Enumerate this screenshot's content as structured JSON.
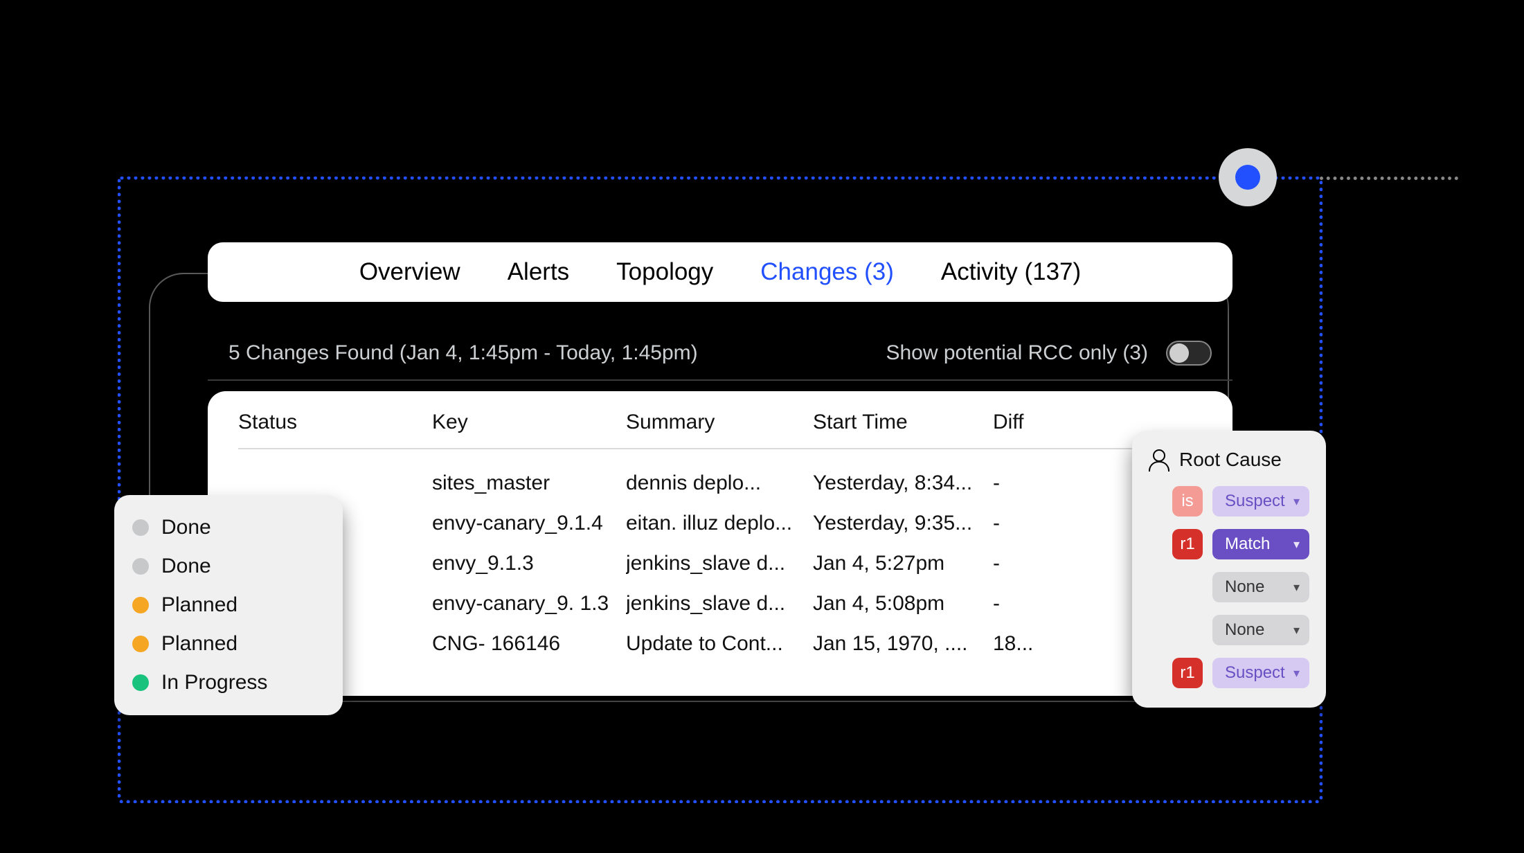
{
  "tabs": {
    "overview": "Overview",
    "alerts": "Alerts",
    "topology": "Topology",
    "changes": "Changes (3)",
    "activity": "Activity (137)"
  },
  "subheader": {
    "found": "5 Changes Found (Jan 4, 1:45pm - Today, 1:45pm)",
    "rcc_label": "Show potential RCC only (3)"
  },
  "table": {
    "headers": {
      "status": "Status",
      "key": "Key",
      "summary": "Summary",
      "start": "Start Time",
      "diff": "Diff"
    },
    "rows": [
      {
        "key": "sites_master",
        "summary": "dennis deplo...",
        "start": "Yesterday, 8:34...",
        "diff": "-"
      },
      {
        "key": "envy-canary_9.1.4",
        "summary": "eitan. illuz deplo...",
        "start": "Yesterday, 9:35...",
        "diff": "-"
      },
      {
        "key": "envy_9.1.3",
        "summary": "jenkins_slave d...",
        "start": "Jan 4, 5:27pm",
        "diff": "-"
      },
      {
        "key": "envy-canary_9. 1.3",
        "summary": "jenkins_slave d...",
        "start": "Jan 4, 5:08pm",
        "diff": "-"
      },
      {
        "key": "CNG- 166146",
        "summary": "Update to Cont...",
        "start": "Jan 15, 1970, ....",
        "diff": "18..."
      }
    ]
  },
  "status_card": {
    "items": [
      {
        "label": "Done",
        "color": "grey"
      },
      {
        "label": "Done",
        "color": "grey"
      },
      {
        "label": "Planned",
        "color": "orange"
      },
      {
        "label": "Planned",
        "color": "orange"
      },
      {
        "label": " In Progress",
        "color": "green"
      }
    ]
  },
  "root_cause": {
    "title": "Root Cause",
    "rows": [
      {
        "badge": "is",
        "badge_style": "pink",
        "pill": "Suspect",
        "pill_style": "lav"
      },
      {
        "badge": "r1",
        "badge_style": "red",
        "pill": "Match",
        "pill_style": "purple"
      },
      {
        "badge": "",
        "badge_style": "",
        "pill": "None",
        "pill_style": "grey"
      },
      {
        "badge": "",
        "badge_style": "",
        "pill": "None",
        "pill_style": "grey"
      },
      {
        "badge": "r1",
        "badge_style": "red",
        "pill": "Suspect",
        "pill_style": "lav"
      }
    ]
  }
}
